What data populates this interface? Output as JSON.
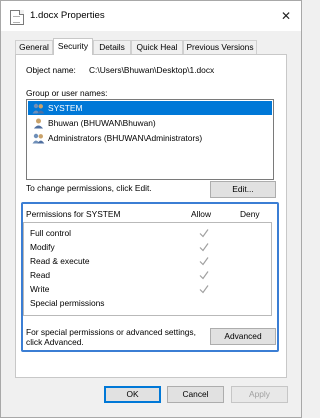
{
  "window": {
    "title": "1.docx Properties",
    "close_glyph": "✕"
  },
  "tabs": [
    {
      "label": "General",
      "active": false
    },
    {
      "label": "Security",
      "active": true
    },
    {
      "label": "Details",
      "active": false
    },
    {
      "label": "Quick Heal",
      "active": false
    },
    {
      "label": "Previous Versions",
      "active": false
    }
  ],
  "security": {
    "object_name_label": "Object name:",
    "object_name_value": "C:\\Users\\Bhuwan\\Desktop\\1.docx",
    "group_label": "Group or user names:",
    "users": [
      {
        "name": "SYSTEM",
        "icon": "users-group-icon",
        "selected": true
      },
      {
        "name": "Bhuwan (BHUWAN\\Bhuwan)",
        "icon": "user-icon",
        "selected": false
      },
      {
        "name": "Administrators (BHUWAN\\Administrators)",
        "icon": "users-group-icon",
        "selected": false
      }
    ],
    "change_text": "To change permissions, click Edit.",
    "edit_button": "Edit...",
    "permissions_title": "Permissions for SYSTEM",
    "allow_header": "Allow",
    "deny_header": "Deny",
    "permissions": [
      {
        "name": "Full control",
        "allow": true,
        "deny": false
      },
      {
        "name": "Modify",
        "allow": true,
        "deny": false
      },
      {
        "name": "Read & execute",
        "allow": true,
        "deny": false
      },
      {
        "name": "Read",
        "allow": true,
        "deny": false
      },
      {
        "name": "Write",
        "allow": true,
        "deny": false
      },
      {
        "name": "Special permissions",
        "allow": false,
        "deny": false
      }
    ],
    "advanced_text_1": "For special permissions or advanced settings,",
    "advanced_text_2": "click Advanced.",
    "advanced_button": "Advanced"
  },
  "footer": {
    "ok": "OK",
    "cancel": "Cancel",
    "apply": "Apply"
  },
  "colors": {
    "selection": "#0078d7",
    "highlight_border": "#3b7ed4",
    "check": "#a0a0a0"
  }
}
